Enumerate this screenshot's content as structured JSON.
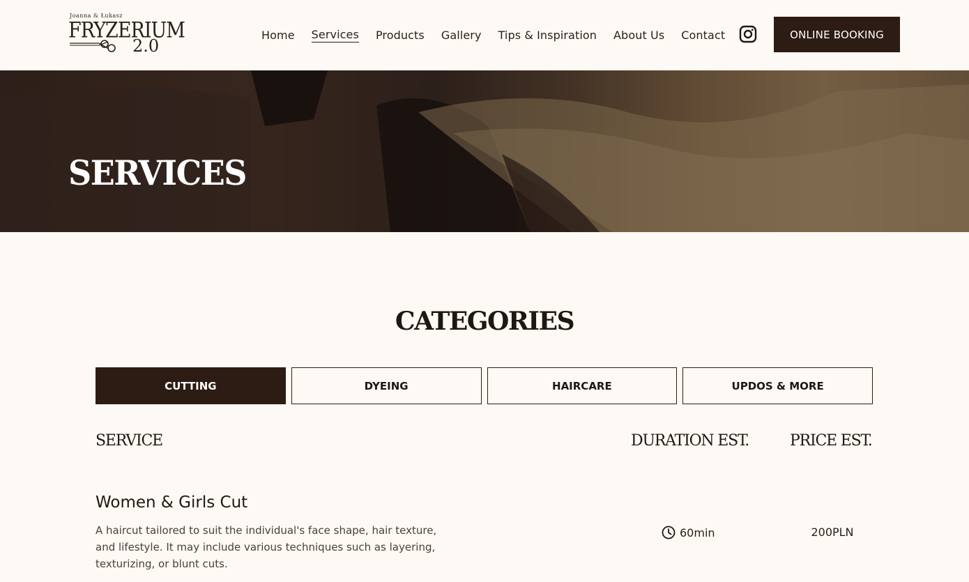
{
  "logo": {
    "top_text": "Joanna & Łukasz",
    "main_text": "FRYZERIUM",
    "version_text": "2.0"
  },
  "nav": {
    "items": [
      {
        "label": "Home"
      },
      {
        "label": "Services",
        "active": true
      },
      {
        "label": "Products"
      },
      {
        "label": "Gallery"
      },
      {
        "label": "Tips & Inspiration"
      },
      {
        "label": "About Us"
      },
      {
        "label": "Contact"
      }
    ],
    "social_icon": "instagram-icon",
    "booking_label": "ONLINE BOOKING"
  },
  "hero": {
    "title": "SERVICES"
  },
  "categories": {
    "heading": "CATEGORIES",
    "tabs": [
      {
        "label": "CUTTING",
        "active": true
      },
      {
        "label": "DYEING"
      },
      {
        "label": "HAIRCARE"
      },
      {
        "label": "UPDOS & MORE"
      }
    ]
  },
  "table": {
    "headers": {
      "service": "SERVICE",
      "duration": "DURATION EST.",
      "price": "PRICE EST."
    },
    "rows": [
      {
        "name": "Women & Girls Cut",
        "description": "A haircut tailored to suit the individual's face shape, hair texture, and lifestyle. It may include various techniques such as layering, texturizing, or blunt cuts.",
        "duration_icon": "clock-icon",
        "duration": "60min",
        "price": "200PLN"
      }
    ]
  },
  "colors": {
    "background": "#fdf9f4",
    "accent_dark": "#2d1c14",
    "text": "#2a1f1a"
  }
}
